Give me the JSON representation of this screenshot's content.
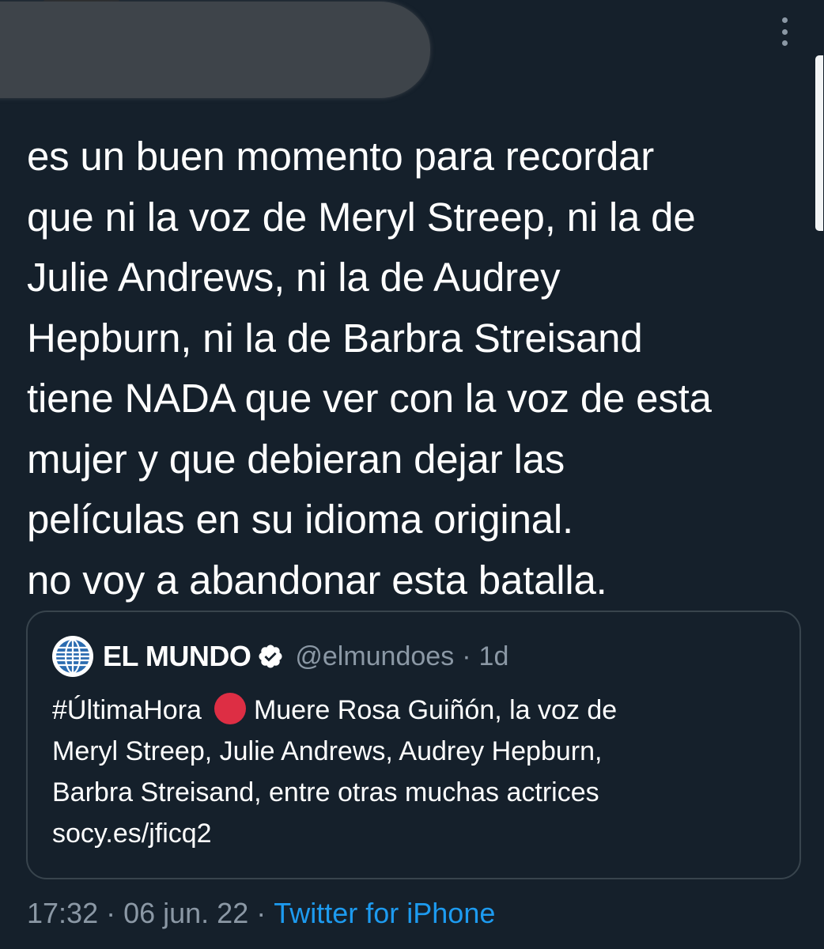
{
  "author": {
    "avatar_icon": "user-avatar",
    "name_redacted": true
  },
  "header": {
    "more_icon": "more-vertical-icon"
  },
  "tweet": {
    "lines": [
      "es un buen momento para recordar",
      "que ni la voz de Meryl Streep, ni la de",
      "Julie Andrews, ni la de Audrey",
      "Hepburn, ni la de Barbra Streisand",
      "tiene NADA que ver con la voz de esta",
      "mujer y que debieran dejar las",
      "películas en su idioma original.",
      "no voy a abandonar esta batalla."
    ]
  },
  "quote": {
    "avatar_icon": "globe-logo-icon",
    "name": "EL MUNDO",
    "verified_icon": "verified-badge-icon",
    "handle": "@elmundoes",
    "separator": "·",
    "time": "1d",
    "hashtag": "#ÚltimaHora",
    "emoji_icon": "red-circle-icon",
    "line1_rest": "Muere Rosa Guiñón, la voz de",
    "line2": "Meryl Streep, Julie Andrews, Audrey Hepburn,",
    "line3": "Barbra Streisand, entre otras muchas actrices",
    "link": "socy.es/jficq2"
  },
  "meta": {
    "time": "17:32",
    "date": "06 jun. 22",
    "separator": "·",
    "source": "Twitter for iPhone"
  },
  "colors": {
    "background": "#15202b",
    "text": "#ffffff",
    "secondary": "#8b98a5",
    "link": "#1d9bf0",
    "border": "#38444d",
    "redaction": "#3e444a",
    "emoji_red": "#dd2e44"
  }
}
